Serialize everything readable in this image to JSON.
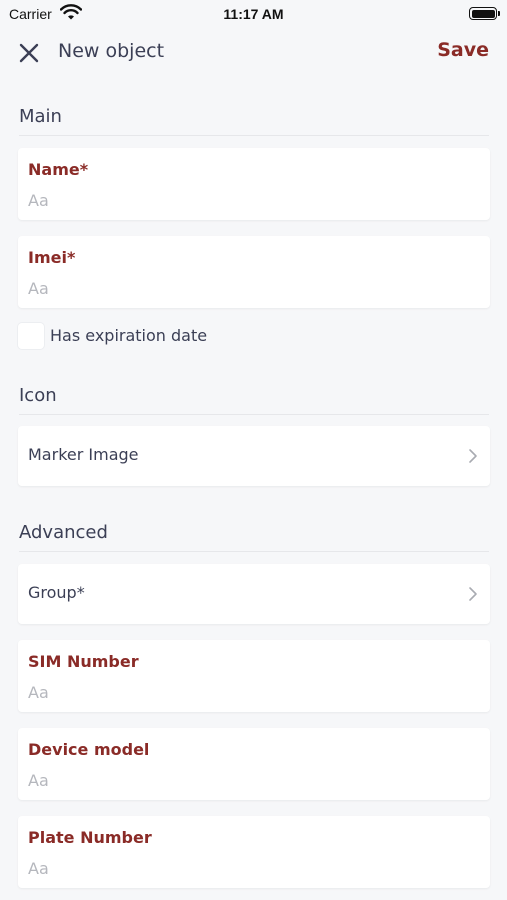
{
  "status_bar": {
    "carrier": "Carrier",
    "time": "11:17 AM"
  },
  "nav": {
    "title": "New object",
    "save_label": "Save"
  },
  "sections": {
    "main": "Main",
    "icon": "Icon",
    "advanced": "Advanced"
  },
  "fields": {
    "name": {
      "label": "Name*",
      "placeholder": "Aa",
      "value": ""
    },
    "imei": {
      "label": "Imei*",
      "placeholder": "Aa",
      "value": ""
    },
    "sim_number": {
      "label": "SIM Number",
      "placeholder": "Aa",
      "value": ""
    },
    "device_model": {
      "label": "Device model",
      "placeholder": "Aa",
      "value": ""
    },
    "plate_number": {
      "label": "Plate Number",
      "placeholder": "Aa",
      "value": ""
    }
  },
  "expiration": {
    "label": "Has expiration date",
    "checked": false
  },
  "rows": {
    "marker_image": "Marker Image",
    "group": "Group*"
  },
  "colors": {
    "accent": "#8a2b27",
    "text": "#3b3f55",
    "placeholder": "#b5b7bd",
    "background": "#f6f7f9"
  },
  "icons": {
    "close": "close-icon",
    "chevron": "chevron-right-icon",
    "wifi": "wifi-icon",
    "battery": "battery-icon"
  }
}
